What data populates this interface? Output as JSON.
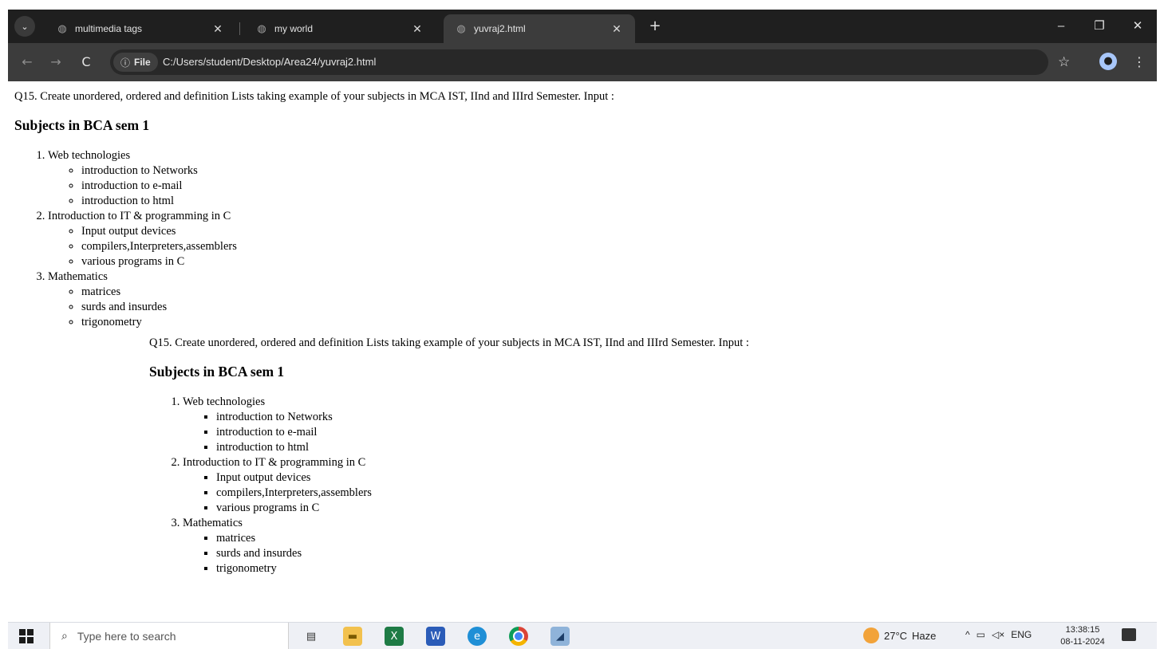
{
  "browser": {
    "tabs": [
      {
        "title": "multimedia tags",
        "active": false
      },
      {
        "title": "my world",
        "active": false
      },
      {
        "title": "yuvraj2.html",
        "active": true
      }
    ],
    "new_tab_icon": "plus-icon",
    "window_controls": {
      "minimize": "–",
      "restore": "❐",
      "close": "✕"
    },
    "toolbar": {
      "back": "←",
      "forward": "→",
      "reload": "C",
      "site_chip_label": "File",
      "url": "C:/Users/student/Desktop/Area24/yuvraj2.html"
    },
    "icons": {
      "menu": "⌄",
      "close_tab": "✕",
      "star": "☆",
      "kebab": "⋮",
      "info": "ⓘ"
    }
  },
  "page": {
    "blocks": [
      {
        "question": "Q15. Create unordered, ordered and definition Lists taking example of your subjects in MCA IST, IInd and IIIrd Semester. Input :",
        "heading": "Subjects in BCA sem 1",
        "bullet_style": "circle",
        "subjects": [
          {
            "name": "Web technologies",
            "topics": [
              "introduction to Networks",
              "introduction to e-mail",
              "introduction to html"
            ]
          },
          {
            "name": "Introduction to IT & programming in C",
            "topics": [
              "Input output devices",
              "compilers,Interpreters,assemblers",
              "various programs in C"
            ]
          },
          {
            "name": "Mathematics",
            "topics": [
              "matrices",
              "surds and insurdes",
              "trigonometry"
            ]
          }
        ]
      },
      {
        "question": "Q15. Create unordered, ordered and definition Lists taking example of your subjects in MCA IST, IInd and IIIrd Semester. Input :",
        "heading": "Subjects in BCA sem 1",
        "bullet_style": "square",
        "subjects": [
          {
            "name": "Web technologies",
            "topics": [
              "introduction to Networks",
              "introduction to e-mail",
              "introduction to html"
            ]
          },
          {
            "name": "Introduction to IT & programming in C",
            "topics": [
              "Input output devices",
              "compilers,Interpreters,assemblers",
              "various programs in C"
            ]
          },
          {
            "name": "Mathematics",
            "topics": [
              "matrices",
              "surds and insurdes",
              "trigonometry"
            ]
          }
        ]
      }
    ]
  },
  "taskbar": {
    "search_placeholder": "Type here to search",
    "apps": [
      "task-view-icon",
      "file-explorer-icon",
      "excel-icon",
      "word-icon",
      "edge-icon",
      "chrome-icon",
      "paint-icon"
    ],
    "weather": {
      "temp": "27°C",
      "condition": "Haze"
    },
    "tray": {
      "chevron": "^",
      "language": "ENG"
    },
    "clock": {
      "time": "13:38:15",
      "date": "08-11-2024"
    }
  }
}
